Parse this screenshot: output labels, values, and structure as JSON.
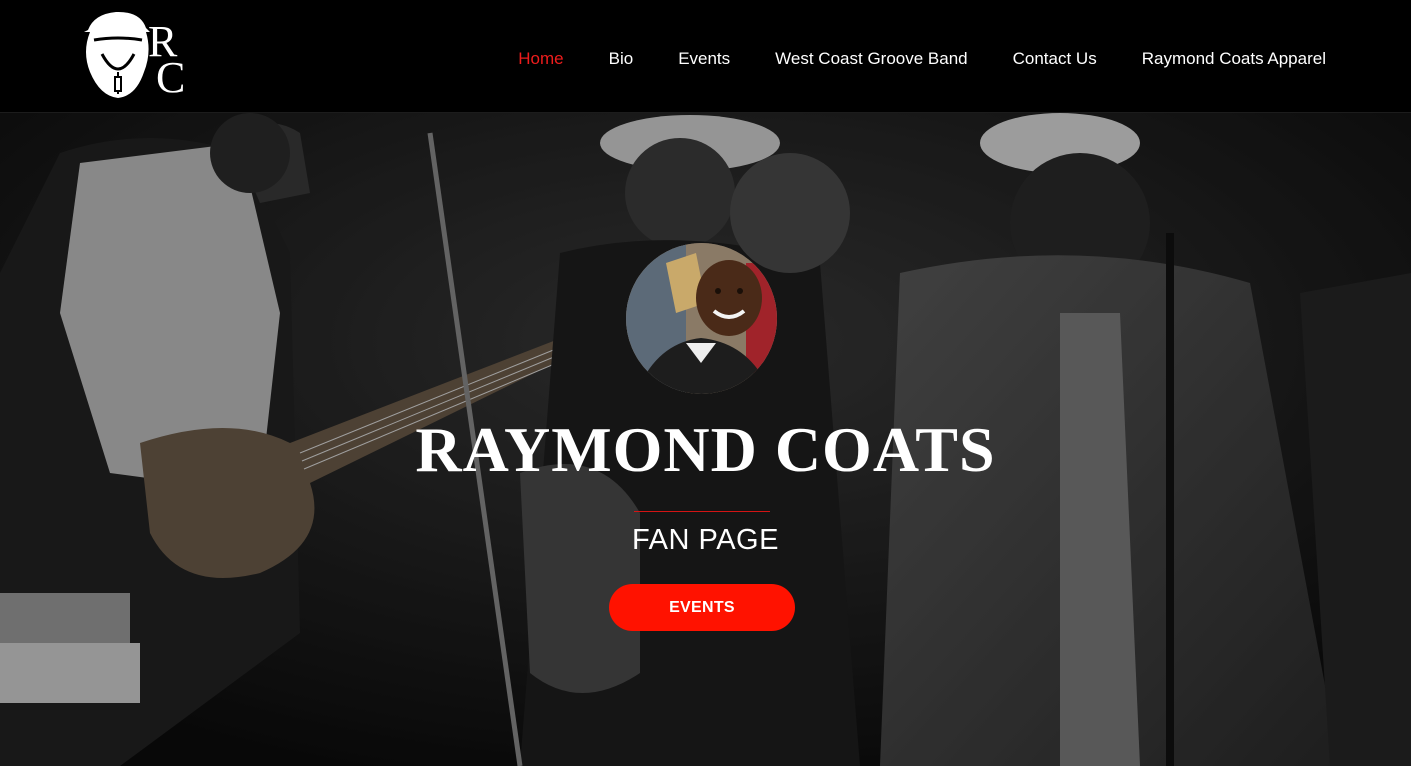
{
  "logo": {
    "letters": "RC"
  },
  "nav": {
    "items": [
      {
        "label": "Home",
        "active": true
      },
      {
        "label": "Bio",
        "active": false
      },
      {
        "label": "Events",
        "active": false
      },
      {
        "label": "West Coast Groove Band",
        "active": false
      },
      {
        "label": "Contact Us",
        "active": false
      },
      {
        "label": "Raymond Coats Apparel",
        "active": false
      }
    ]
  },
  "hero": {
    "title": "RAYMOND COATS",
    "subtitle": "FAN PAGE",
    "cta_label": "EVENTS"
  },
  "colors": {
    "accent": "#ff1200",
    "nav_active": "#ee1c1c",
    "header_bg": "#000000",
    "text": "#ffffff"
  }
}
